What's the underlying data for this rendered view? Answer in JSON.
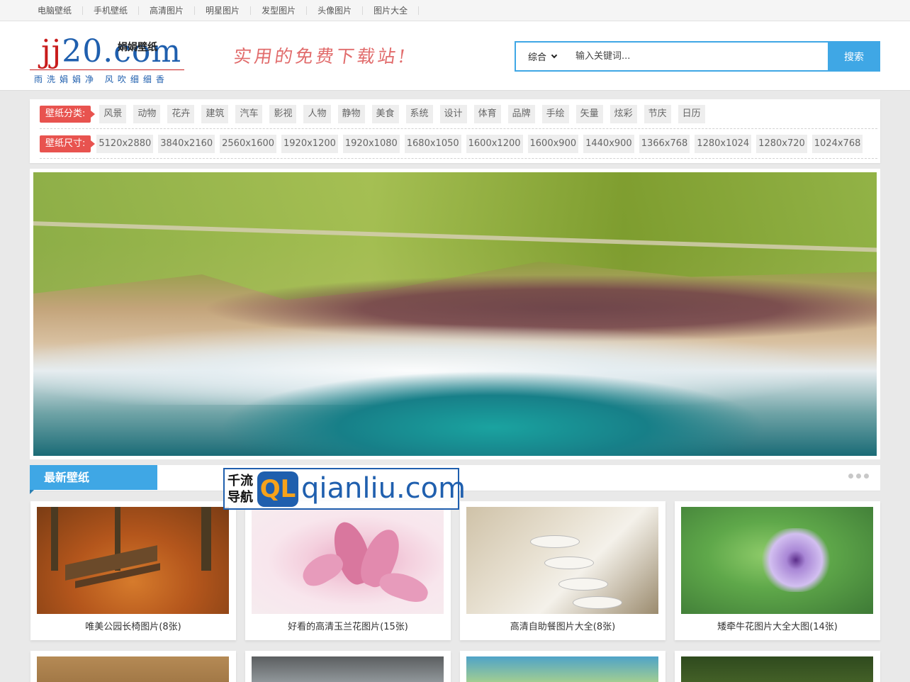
{
  "topnav": {
    "items": [
      "电脑壁纸",
      "手机壁纸",
      "高清图片",
      "明星图片",
      "发型图片",
      "头像图片",
      "图片大全"
    ]
  },
  "header": {
    "logo_main_a": "jj",
    "logo_main_b": "20",
    "logo_main_c": ".com",
    "logo_sub": "娟娟壁纸",
    "logo_tagline": "雨洗娟娟净 风吹细细香",
    "slogan": "实用的免费下载站!",
    "search": {
      "select_value": "综合",
      "placeholder": "输入关键词...",
      "button_label": "搜索"
    }
  },
  "filter": {
    "category_label": "壁纸分类:",
    "categories": [
      "风景",
      "动物",
      "花卉",
      "建筑",
      "汽车",
      "影视",
      "人物",
      "静物",
      "美食",
      "系统",
      "设计",
      "体育",
      "品牌",
      "手绘",
      "矢量",
      "炫彩",
      "节庆",
      "日历"
    ],
    "size_label": "壁纸尺寸:",
    "sizes": [
      "5120x2880",
      "3840x2160",
      "2560x1600",
      "1920x1200",
      "1920x1080",
      "1680x1050",
      "1600x1200",
      "1600x900",
      "1440x900",
      "1366x768",
      "1280x1024",
      "1280x720",
      "1024x768"
    ]
  },
  "section": {
    "title": "最新壁纸"
  },
  "watermark": {
    "cn_line1": "千流",
    "cn_line2": "导航",
    "badge": "QL",
    "domain": "qianliu.com"
  },
  "cards": [
    {
      "caption": "唯美公园长椅图片(8张)"
    },
    {
      "caption": "好看的高清玉兰花图片(15张)"
    },
    {
      "caption": "高清自助餐图片大全(8张)"
    },
    {
      "caption": "矮牵牛花图片大全大图(14张)"
    }
  ],
  "colors": {
    "accent_blue": "#3fa7e5",
    "label_red": "#e8534f",
    "logo_red": "#c81c1c",
    "logo_blue": "#1f5fae"
  }
}
